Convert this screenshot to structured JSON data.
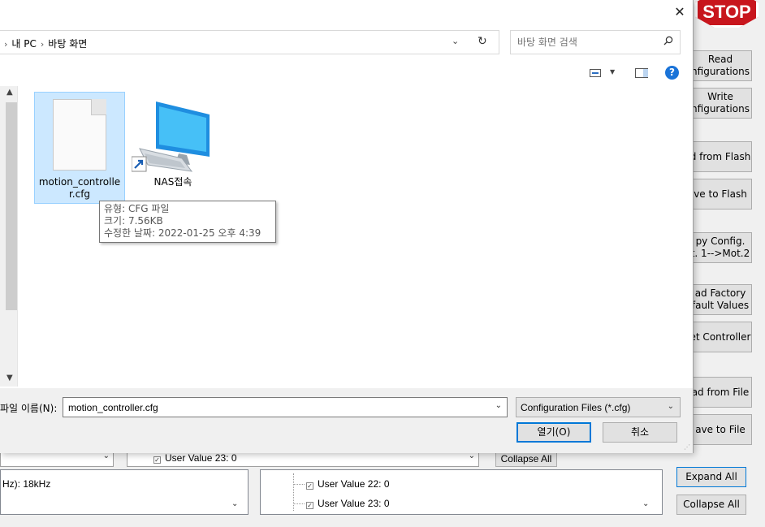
{
  "app": {
    "stop_label": "STOP",
    "side_buttons": [
      {
        "label1": "Read",
        "label2": "nfigurations"
      },
      {
        "label1": "Write",
        "label2": "nfigurations"
      },
      {
        "label1": "d from Flash"
      },
      {
        "label1": "ve to Flash"
      },
      {
        "label1": "py Config.",
        "label2": "t. 1-->Mot.2"
      },
      {
        "label1": "ad Factory",
        "label2": "fault Values"
      },
      {
        "label1": "et Controller"
      },
      {
        "label1": "ad from File"
      },
      {
        "label1": "ave to File"
      },
      {
        "label1": "Expand All"
      },
      {
        "label1": "Collapse All"
      }
    ],
    "lower": {
      "left_freq_text": "Hz): 18kHz",
      "mid_items": [
        "User Value 22: 0",
        "User Value 23: 0"
      ],
      "middle_combo_item": "User Value 23: 0",
      "mid_collapse": "Collapse All"
    }
  },
  "dialog": {
    "close_glyph": "✕",
    "breadcrumb": [
      "내 PC",
      "바탕 화면"
    ],
    "breadcrumb_sep": "›",
    "dropdown_glyph": "⌄",
    "refresh_glyph": "↻",
    "search_placeholder": "바탕 화면 검색",
    "search_icon": "search-icon",
    "help_glyph": "?",
    "files": [
      {
        "name_line1": "motion_controlle",
        "name_line2": "r.cfg",
        "icon": "document-icon",
        "selected": true
      },
      {
        "name_line1": "NAS접속",
        "icon": "computer-shortcut-icon",
        "selected": false
      }
    ],
    "tooltip": {
      "type": "유형: CFG 파일",
      "size": "크기: 7.56KB",
      "modified": "수정한 날짜: 2022-01-25 오후 4:39"
    },
    "filename_label": "파일 이름(N):",
    "filename_value": "motion_controller.cfg",
    "filetype_value": "Configuration Files (*.cfg)",
    "open_label": "열기(O)",
    "cancel_label": "취소"
  }
}
